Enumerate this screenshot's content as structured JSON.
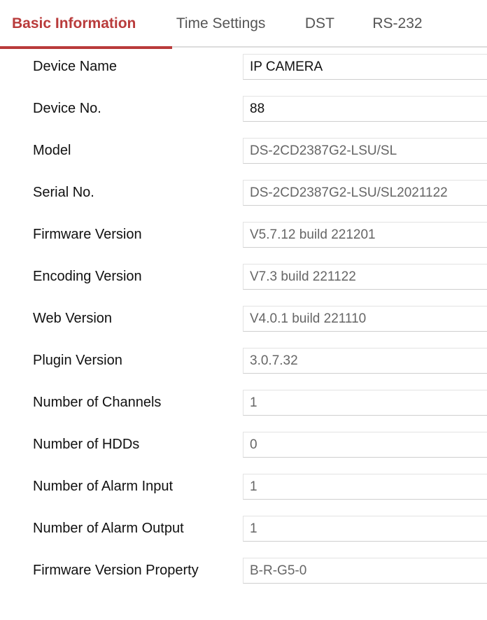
{
  "theme": {
    "accent": "#b93b3b",
    "label_color": "#111111",
    "readonly_value_color": "#666666",
    "editable_value_color": "#111111",
    "field_border": "#e3e3e3",
    "tab_inactive_color": "#555555",
    "tabbar_border": "#dcdcdc"
  },
  "tabs": [
    {
      "label": "Basic Information",
      "active": true
    },
    {
      "label": "Time Settings",
      "active": false
    },
    {
      "label": "DST",
      "active": false
    },
    {
      "label": "RS-232",
      "active": false
    }
  ],
  "form": {
    "rows": [
      {
        "label": "Device Name",
        "value": "IP CAMERA",
        "readonly": false
      },
      {
        "label": "Device No.",
        "value": "88",
        "readonly": false
      },
      {
        "label": "Model",
        "value": "DS-2CD2387G2-LSU/SL",
        "readonly": true
      },
      {
        "label": "Serial No.",
        "value": "DS-2CD2387G2-LSU/SL2021122",
        "readonly": true
      },
      {
        "label": "Firmware Version",
        "value": "V5.7.12 build 221201",
        "readonly": true
      },
      {
        "label": "Encoding Version",
        "value": "V7.3 build 221122",
        "readonly": true
      },
      {
        "label": "Web Version",
        "value": "V4.0.1 build 221110",
        "readonly": true
      },
      {
        "label": "Plugin Version",
        "value": "3.0.7.32",
        "readonly": true
      },
      {
        "label": "Number of Channels",
        "value": "1",
        "readonly": true
      },
      {
        "label": "Number of HDDs",
        "value": "0",
        "readonly": true
      },
      {
        "label": "Number of Alarm Input",
        "value": "1",
        "readonly": true
      },
      {
        "label": "Number of Alarm Output",
        "value": "1",
        "readonly": true
      },
      {
        "label": "Firmware Version Property",
        "value": "B-R-G5-0",
        "readonly": true
      }
    ]
  }
}
